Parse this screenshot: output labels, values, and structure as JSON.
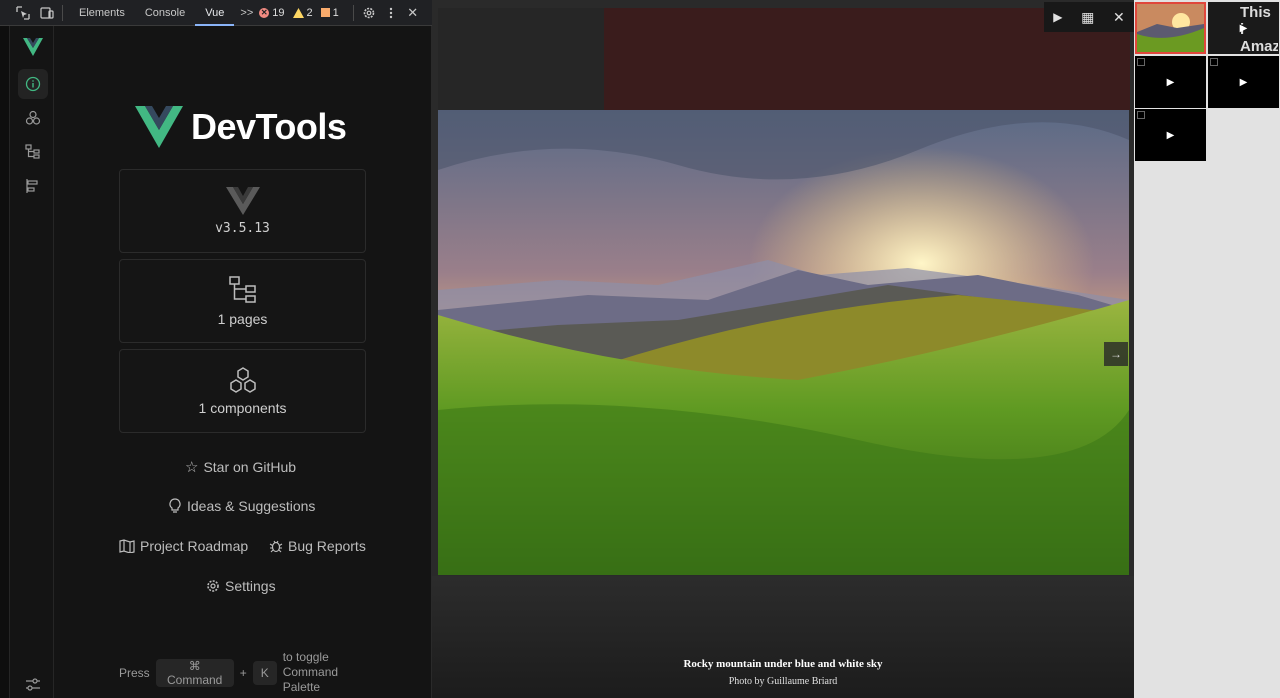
{
  "devtools": {
    "tabs": {
      "elements": "Elements",
      "console": "Console",
      "vue": "Vue",
      "more": ">>"
    },
    "badges": {
      "errors": "19",
      "warnings": "2",
      "issues": "1"
    },
    "close": "✕"
  },
  "vue": {
    "logo_text": "DevTools",
    "version": "v3.5.13",
    "pages": "1 pages",
    "components": "1 components",
    "links": {
      "github": "Star on GitHub",
      "ideas": "Ideas & Suggestions",
      "roadmap": "Project Roadmap",
      "bugs": "Bug Reports",
      "settings": "Settings"
    },
    "palette": {
      "press": "Press",
      "cmd_symbol": "⌘",
      "cmd_label": "Command",
      "plus": "+",
      "k": "K",
      "hint": "to toggle Command Palette"
    },
    "accent": "#42b883"
  },
  "viewer": {
    "toolbar": {
      "play": "▶",
      "grid": "▦",
      "close": "✕"
    },
    "next": "→",
    "caption_title": "Rocky mountain under blue and white sky",
    "caption_sub": "Photo by Guillaume Briard"
  },
  "thumbs": {
    "video_text": "This i Amazi",
    "play": "▶"
  }
}
